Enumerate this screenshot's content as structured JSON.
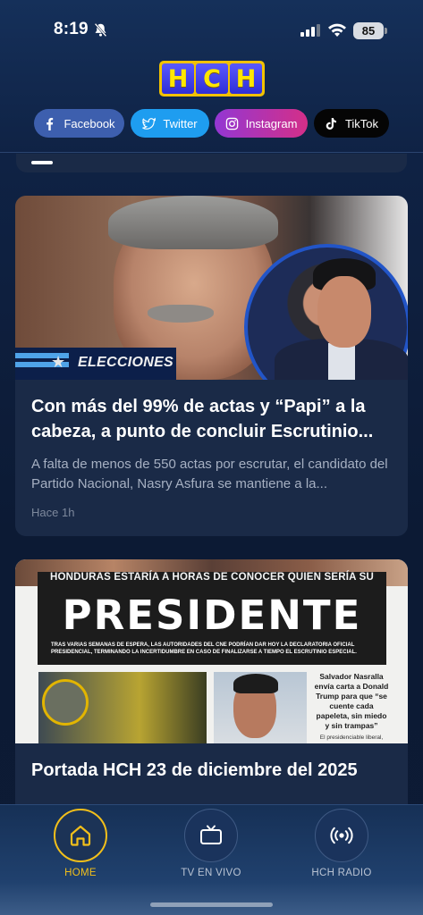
{
  "status_bar": {
    "time": "8:19",
    "battery": "85"
  },
  "header": {
    "logo_letters": [
      "H",
      "C",
      "H"
    ],
    "social": [
      {
        "label": "Facebook",
        "icon": "facebook-icon",
        "color": "#3d5fae"
      },
      {
        "label": "Twitter",
        "icon": "twitter-icon",
        "color": "#1e9df0"
      },
      {
        "label": "Instagram",
        "icon": "instagram-icon",
        "color": "#c0339f"
      },
      {
        "label": "TikTok",
        "icon": "tiktok-icon",
        "color": "#050505"
      }
    ]
  },
  "feed": [
    {
      "title": "Con más del 99% de actas y “Papi” a la cabeza, a punto de concluir Escrutinio...",
      "summary": "A falta de menos de 550 actas por escrutar, el candidato del Partido Nacional, Nasry Asfura se mantiene a la...",
      "time": "Hace 1h",
      "image_text": "ELECCIONES"
    },
    {
      "title": "Portada HCH 23 de diciembre del 2025",
      "image_kicker": "HONDURAS ESTARÍA A HORAS DE CONOCER QUIEN SERÍA SU",
      "image_headline": "PRESIDENTE",
      "image_deck": "TRAS VARIAS SEMANAS DE ESPERA, LAS AUTORIDADES DEL CNE PODRÍAN DAR HOY LA DECLARATORIA OFICIAL PRESIDENCIAL, TERMINANDO LA INCERTIDUMBRE EN CASO DE FINALIZARSE A TIEMPO EL ESCRUTINIO ESPECIAL.",
      "image_side_note": "Salvador Nasralla envía carta a Donald Trump para que “se cuente cada papeleta, sin miedo y sin trampas”",
      "image_side_caption": "El presidenciable liberal,"
    }
  ],
  "bottom_nav": {
    "items": [
      {
        "label": "HOME",
        "icon": "home-icon",
        "active": true
      },
      {
        "label": "TV EN VIVO",
        "icon": "tv-icon",
        "active": false
      },
      {
        "label": "HCH RADIO",
        "icon": "radio-icon",
        "active": false
      }
    ],
    "active_color": "#f2bf1a"
  }
}
